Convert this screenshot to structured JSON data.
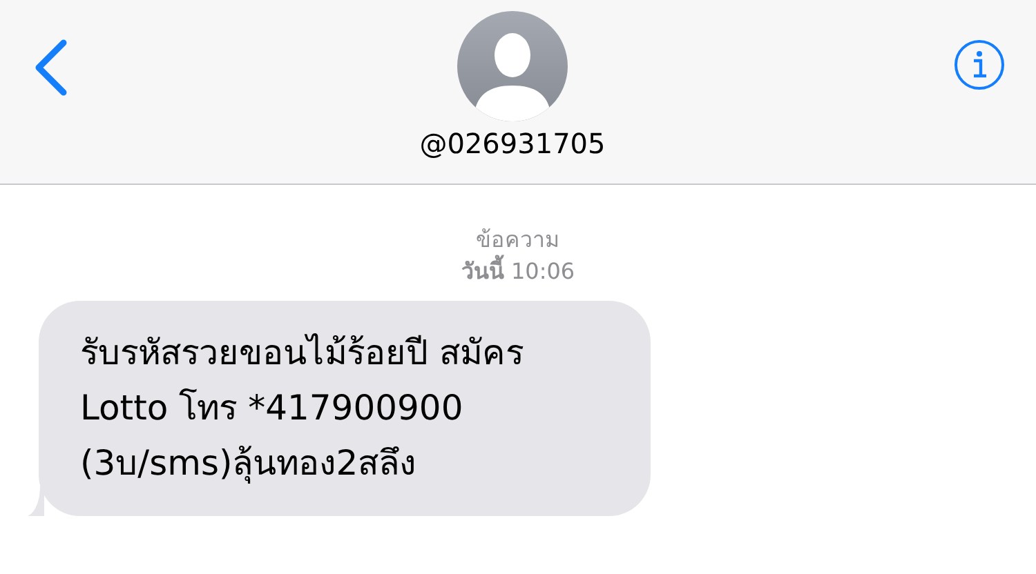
{
  "header": {
    "contact": "@026931705"
  },
  "conversation": {
    "label": "ข้อความ",
    "timestamp": "**วันนี้** 10:06"
  },
  "messages": [
    {
      "kind": "incoming",
      "text": "รับรหัสรวยขอนไม้ร้อยปี สมัคร Lotto โทร *417900900 (3บ/sms)ลุ้นทอง2สลึง"
    }
  ]
}
